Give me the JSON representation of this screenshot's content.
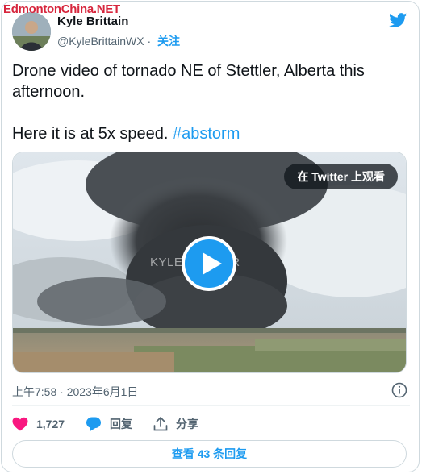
{
  "watermark": "EdmontonChina.NET",
  "author": {
    "name": "Kyle Brittain",
    "handle": "@KyleBrittainWX",
    "separator": "·",
    "follow_label": "关注"
  },
  "tweet": {
    "line1": "Drone video of tornado NE of Stettler, Alberta this afternoon.",
    "line2_text": "Here it is at 5x speed. ",
    "hashtag": "#abstorm"
  },
  "media": {
    "watch_label": "在 Twitter 上观看",
    "video_watermark": "KYLE B        ATHER"
  },
  "timestamp": "上午7:58 · 2023年6月1日",
  "actions": {
    "likes_count": "1,727",
    "reply_label": "回复",
    "share_label": "分享"
  },
  "view_replies_label": "查看 43 条回复",
  "colors": {
    "accent": "#1d9bf0",
    "like": "#f91880",
    "watermark": "#d7263d"
  }
}
